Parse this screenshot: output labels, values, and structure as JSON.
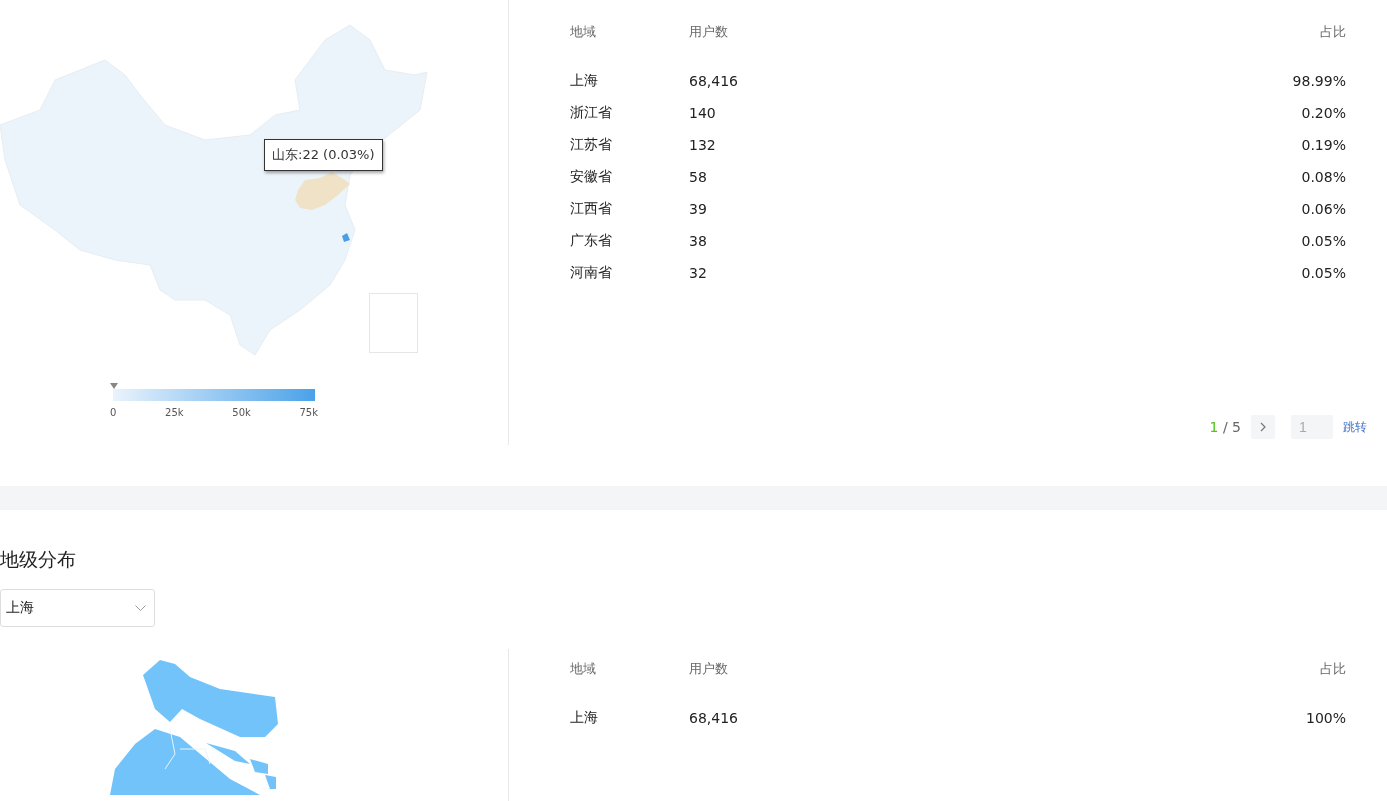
{
  "province_section": {
    "map": {
      "tooltip": "山东:22 (0.03%)",
      "legend": {
        "ticks": [
          "0",
          "25k",
          "50k",
          "75k"
        ]
      }
    },
    "table": {
      "columns": [
        "地域",
        "用户数",
        "占比"
      ],
      "rows": [
        [
          "上海",
          "68,416",
          "98.99%"
        ],
        [
          "浙江省",
          "140",
          "0.20%"
        ],
        [
          "江苏省",
          "132",
          "0.19%"
        ],
        [
          "安徽省",
          "58",
          "0.08%"
        ],
        [
          "江西省",
          "39",
          "0.06%"
        ],
        [
          "广东省",
          "38",
          "0.05%"
        ],
        [
          "河南省",
          "32",
          "0.05%"
        ]
      ]
    },
    "pagination": {
      "current": "1",
      "total": "/ 5",
      "jump_value": "1",
      "jump_label": "跳转"
    }
  },
  "city_section": {
    "title": "地级分布",
    "select": {
      "value": "上海"
    },
    "table": {
      "columns": [
        "地域",
        "用户数",
        "占比"
      ],
      "rows": [
        [
          "上海",
          "68,416",
          "100%"
        ]
      ]
    }
  }
}
